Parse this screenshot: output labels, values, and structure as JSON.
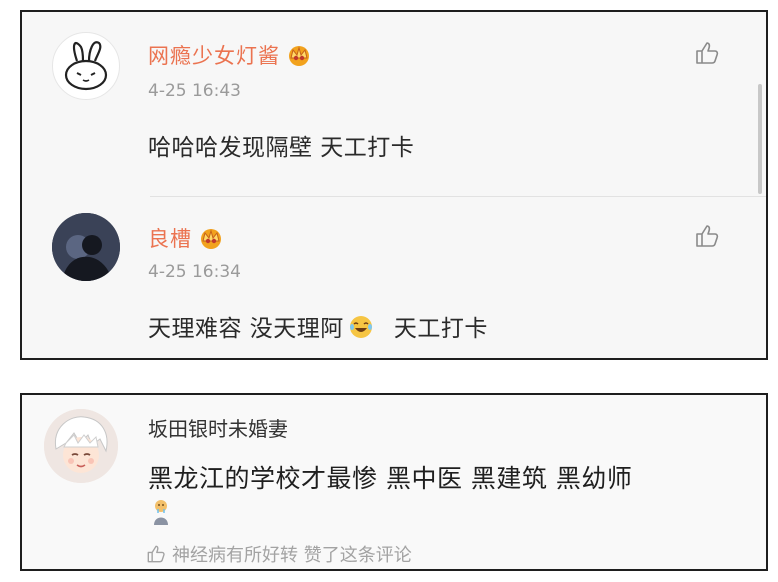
{
  "comments": [
    {
      "username": "网瘾少女灯酱",
      "time": "4-25 16:43",
      "text": "哈哈哈发现隔壁 天工打卡",
      "avatar_icon": "bunny-doodle-avatar",
      "badge_icon": "crown-icon"
    },
    {
      "username": "良槽",
      "time": "4-25 16:34",
      "text_before": "天理难容 没天理阿",
      "emoji_icon": "laughing-tears-emoji",
      "text_after": "天工打卡",
      "avatar_icon": "dark-silhouette-avatar",
      "badge_icon": "crown-icon"
    }
  ],
  "reply": {
    "username": "坂田银时未婚妻",
    "text": "黑龙江的学校才最惨 黑中医 黑建筑 黑幼师",
    "emoji_icon": "crying-figure-emoji",
    "footer": "神经病有所好转 赞了这条评论",
    "avatar_icon": "anime-boy-avatar"
  },
  "colors": {
    "username_accent": "#eb7350",
    "time_gray": "#9a9a9a",
    "footer_gray": "#a3a3a3",
    "border": "#1e1e1e"
  }
}
